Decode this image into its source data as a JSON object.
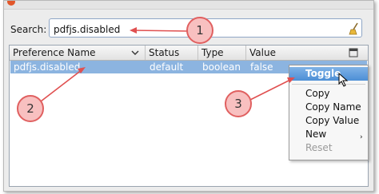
{
  "search": {
    "label": "Search:",
    "value": "pdfjs.disabled"
  },
  "columns": {
    "name": "Preference Name",
    "status": "Status",
    "type": "Type",
    "value": "Value"
  },
  "row": {
    "name": "pdfjs.disabled",
    "status": "default",
    "type": "boolean",
    "value": "false"
  },
  "callouts": [
    "1",
    "2",
    "3"
  ],
  "menu": {
    "items": [
      "Toggle",
      "Copy",
      "Copy Name",
      "Copy Value",
      "New",
      "Reset"
    ]
  },
  "colors": {
    "selection": "#8cb4e0",
    "menu_highlight": "#4c8fd6",
    "callout_fill": "#f8c0c0",
    "callout_stroke": "#e06060"
  }
}
